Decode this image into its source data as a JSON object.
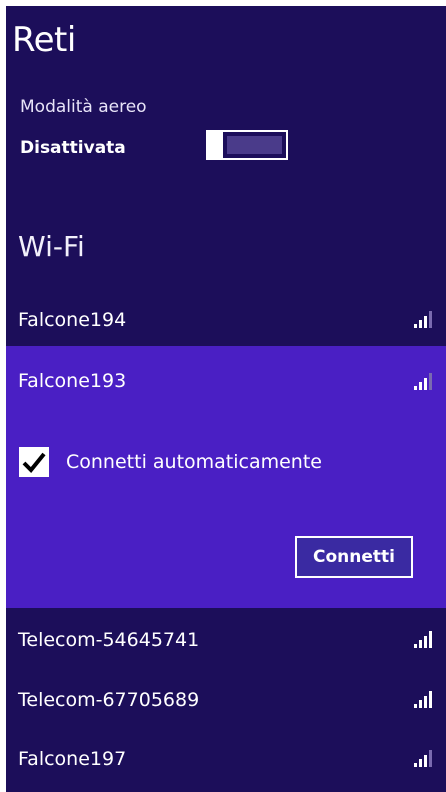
{
  "header": {
    "title": "Reti"
  },
  "airplane": {
    "label": "Modalità aereo",
    "state": "Disattivata"
  },
  "wifi": {
    "section_title": "Wi-Fi",
    "networks": [
      {
        "name": "Falcone194",
        "signal_bars": 3
      },
      {
        "name": "Falcone193",
        "signal_bars": 3,
        "selected": true
      },
      {
        "name": "Telecom-54645741",
        "signal_bars": 4
      },
      {
        "name": "Telecom-67705689",
        "signal_bars": 4
      },
      {
        "name": "Falcone197",
        "signal_bars": 3
      }
    ],
    "auto_connect": {
      "label": "Connetti automaticamente",
      "checked": true
    },
    "connect_label": "Connetti"
  },
  "colors": {
    "background": "#1c0e5a",
    "selected_background": "#4a1fc4",
    "text": "#ffffff"
  },
  "icons": [
    "signal-strength-icon",
    "checkmark-icon"
  ]
}
